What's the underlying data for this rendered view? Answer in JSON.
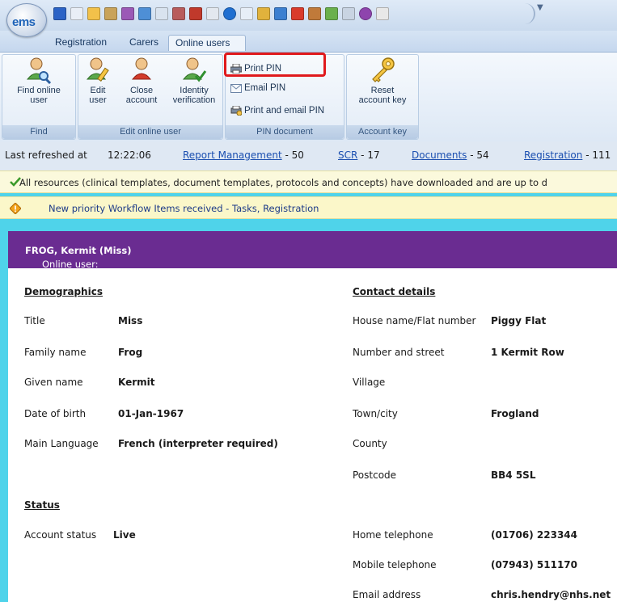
{
  "app": {
    "logo": "ems"
  },
  "tabs": [
    {
      "label": "Registration",
      "active": false
    },
    {
      "label": "Carers",
      "active": false
    },
    {
      "label": "Online users",
      "active": true
    }
  ],
  "ribbon": {
    "groups": {
      "find": {
        "label": "Find",
        "button": "Find online user"
      },
      "edit": {
        "label": "Edit online user",
        "buttons": [
          "Edit user",
          "Close account",
          "Identity verification"
        ]
      },
      "pin": {
        "label": "PIN document",
        "items": [
          "Print PIN",
          "Email PIN",
          "Print and email PIN"
        ]
      },
      "account": {
        "label": "Account key",
        "button": "Reset account key"
      }
    }
  },
  "status": {
    "last_refreshed_label": "Last refreshed at",
    "time": "12:22:06",
    "links": [
      {
        "label": "Report Management",
        "count": "50"
      },
      {
        "label": "SCR",
        "count": "17"
      },
      {
        "label": "Documents",
        "count": "54"
      },
      {
        "label": "Registration",
        "count": "111"
      }
    ]
  },
  "notices": [
    "All resources (clinical templates, document templates, protocols and concepts) have downloaded and are up to d",
    "New priority Workflow Items received - Tasks, Registration"
  ],
  "header": {
    "prefix": "Online user:",
    "name": "FROG, Kermit (Miss)"
  },
  "demographics": {
    "heading": "Demographics",
    "rows": [
      {
        "label": "Title",
        "value": "Miss"
      },
      {
        "label": "Family name",
        "value": "Frog"
      },
      {
        "label": "Given name",
        "value": "Kermit"
      },
      {
        "label": "Date of birth",
        "value": "01-Jan-1967"
      },
      {
        "label": "Main Language",
        "value": "French (interpreter required)"
      }
    ]
  },
  "status_section": {
    "heading": "Status",
    "rows": [
      {
        "label": "Account status",
        "value": "Live"
      }
    ]
  },
  "contact": {
    "heading": "Contact details",
    "rows": [
      {
        "label": "House name/Flat number",
        "value": "Piggy Flat"
      },
      {
        "label": "Number and street",
        "value": "1 Kermit Row"
      },
      {
        "label": "Village",
        "value": ""
      },
      {
        "label": "Town/city",
        "value": "Frogland"
      },
      {
        "label": "County",
        "value": ""
      },
      {
        "label": "Postcode",
        "value": "BB4 5SL"
      },
      {
        "label": "Home telephone",
        "value": "(01706) 223344"
      },
      {
        "label": "Mobile telephone",
        "value": "(07943) 511170"
      },
      {
        "label": "Email address",
        "value": "chris.hendry@nhs.net"
      }
    ]
  }
}
